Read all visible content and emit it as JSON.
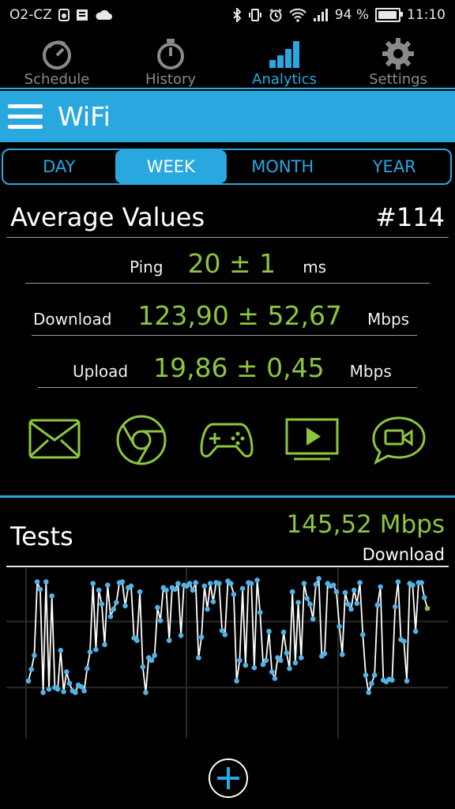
{
  "status_bar": {
    "carrier": "O2-CZ",
    "battery": "94 %",
    "battery_level": 0.94,
    "time": "11:10"
  },
  "nav_tabs": [
    {
      "label": "Schedule",
      "icon": "stopwatch-icon",
      "active": false
    },
    {
      "label": "History",
      "icon": "timer-icon",
      "active": false
    },
    {
      "label": "Analytics",
      "icon": "bar-chart-icon",
      "active": true
    },
    {
      "label": "Settings",
      "icon": "gear-icon",
      "active": false
    }
  ],
  "app_bar": {
    "title": "WiFi"
  },
  "period_tabs": [
    {
      "label": "DAY",
      "active": false
    },
    {
      "label": "WEEK",
      "active": true
    },
    {
      "label": "MONTH",
      "active": false
    },
    {
      "label": "YEAR",
      "active": false
    }
  ],
  "average": {
    "title": "Average Values",
    "count": "#114",
    "ping": {
      "label": "Ping",
      "value": "20 ± 1",
      "unit": "ms"
    },
    "download": {
      "label": "Download",
      "value": "123,90 ± 52,67",
      "unit": "Mbps"
    },
    "upload": {
      "label": "Upload",
      "value": "19,86 ± 0,45",
      "unit": "Mbps"
    }
  },
  "usage_icons": [
    "mail-icon",
    "chrome-icon",
    "gamepad-icon",
    "tv-play-icon",
    "video-chat-icon"
  ],
  "tests": {
    "title": "Tests",
    "value": "145,52 Mbps",
    "kind": "Download"
  },
  "colors": {
    "accent": "#29a8e0",
    "value_green": "#8cc63f",
    "point_blue": "#4fb3e6"
  },
  "chart_data": {
    "type": "line",
    "ylim": [
      0,
      180
    ],
    "grid": true,
    "values": [
      48,
      62,
      79,
      168,
      159,
      34,
      168,
      38,
      151,
      40,
      38,
      85,
      35,
      59,
      45,
      36,
      34,
      43,
      41,
      36,
      63,
      83,
      166,
      86,
      158,
      141,
      92,
      164,
      126,
      135,
      143,
      167,
      168,
      139,
      161,
      163,
      100,
      97,
      156,
      65,
      34,
      76,
      73,
      79,
      137,
      121,
      161,
      158,
      97,
      161,
      159,
      166,
      103,
      164,
      163,
      166,
      158,
      167,
      76,
      101,
      163,
      135,
      166,
      144,
      167,
      166,
      109,
      104,
      169,
      166,
      153,
      48,
      73,
      160,
      67,
      167,
      166,
      64,
      170,
      131,
      68,
      73,
      108,
      59,
      51,
      76,
      73,
      107,
      82,
      63,
      156,
      70,
      143,
      76,
      166,
      148,
      141,
      123,
      165,
      172,
      78,
      81,
      166,
      163,
      164,
      156,
      114,
      80,
      155,
      141,
      135,
      158,
      142,
      167,
      104,
      55,
      34,
      45,
      55,
      140,
      162,
      49,
      47,
      50,
      49,
      138,
      168,
      98,
      96,
      48,
      166,
      164,
      108,
      167,
      167,
      149,
      136
    ]
  }
}
